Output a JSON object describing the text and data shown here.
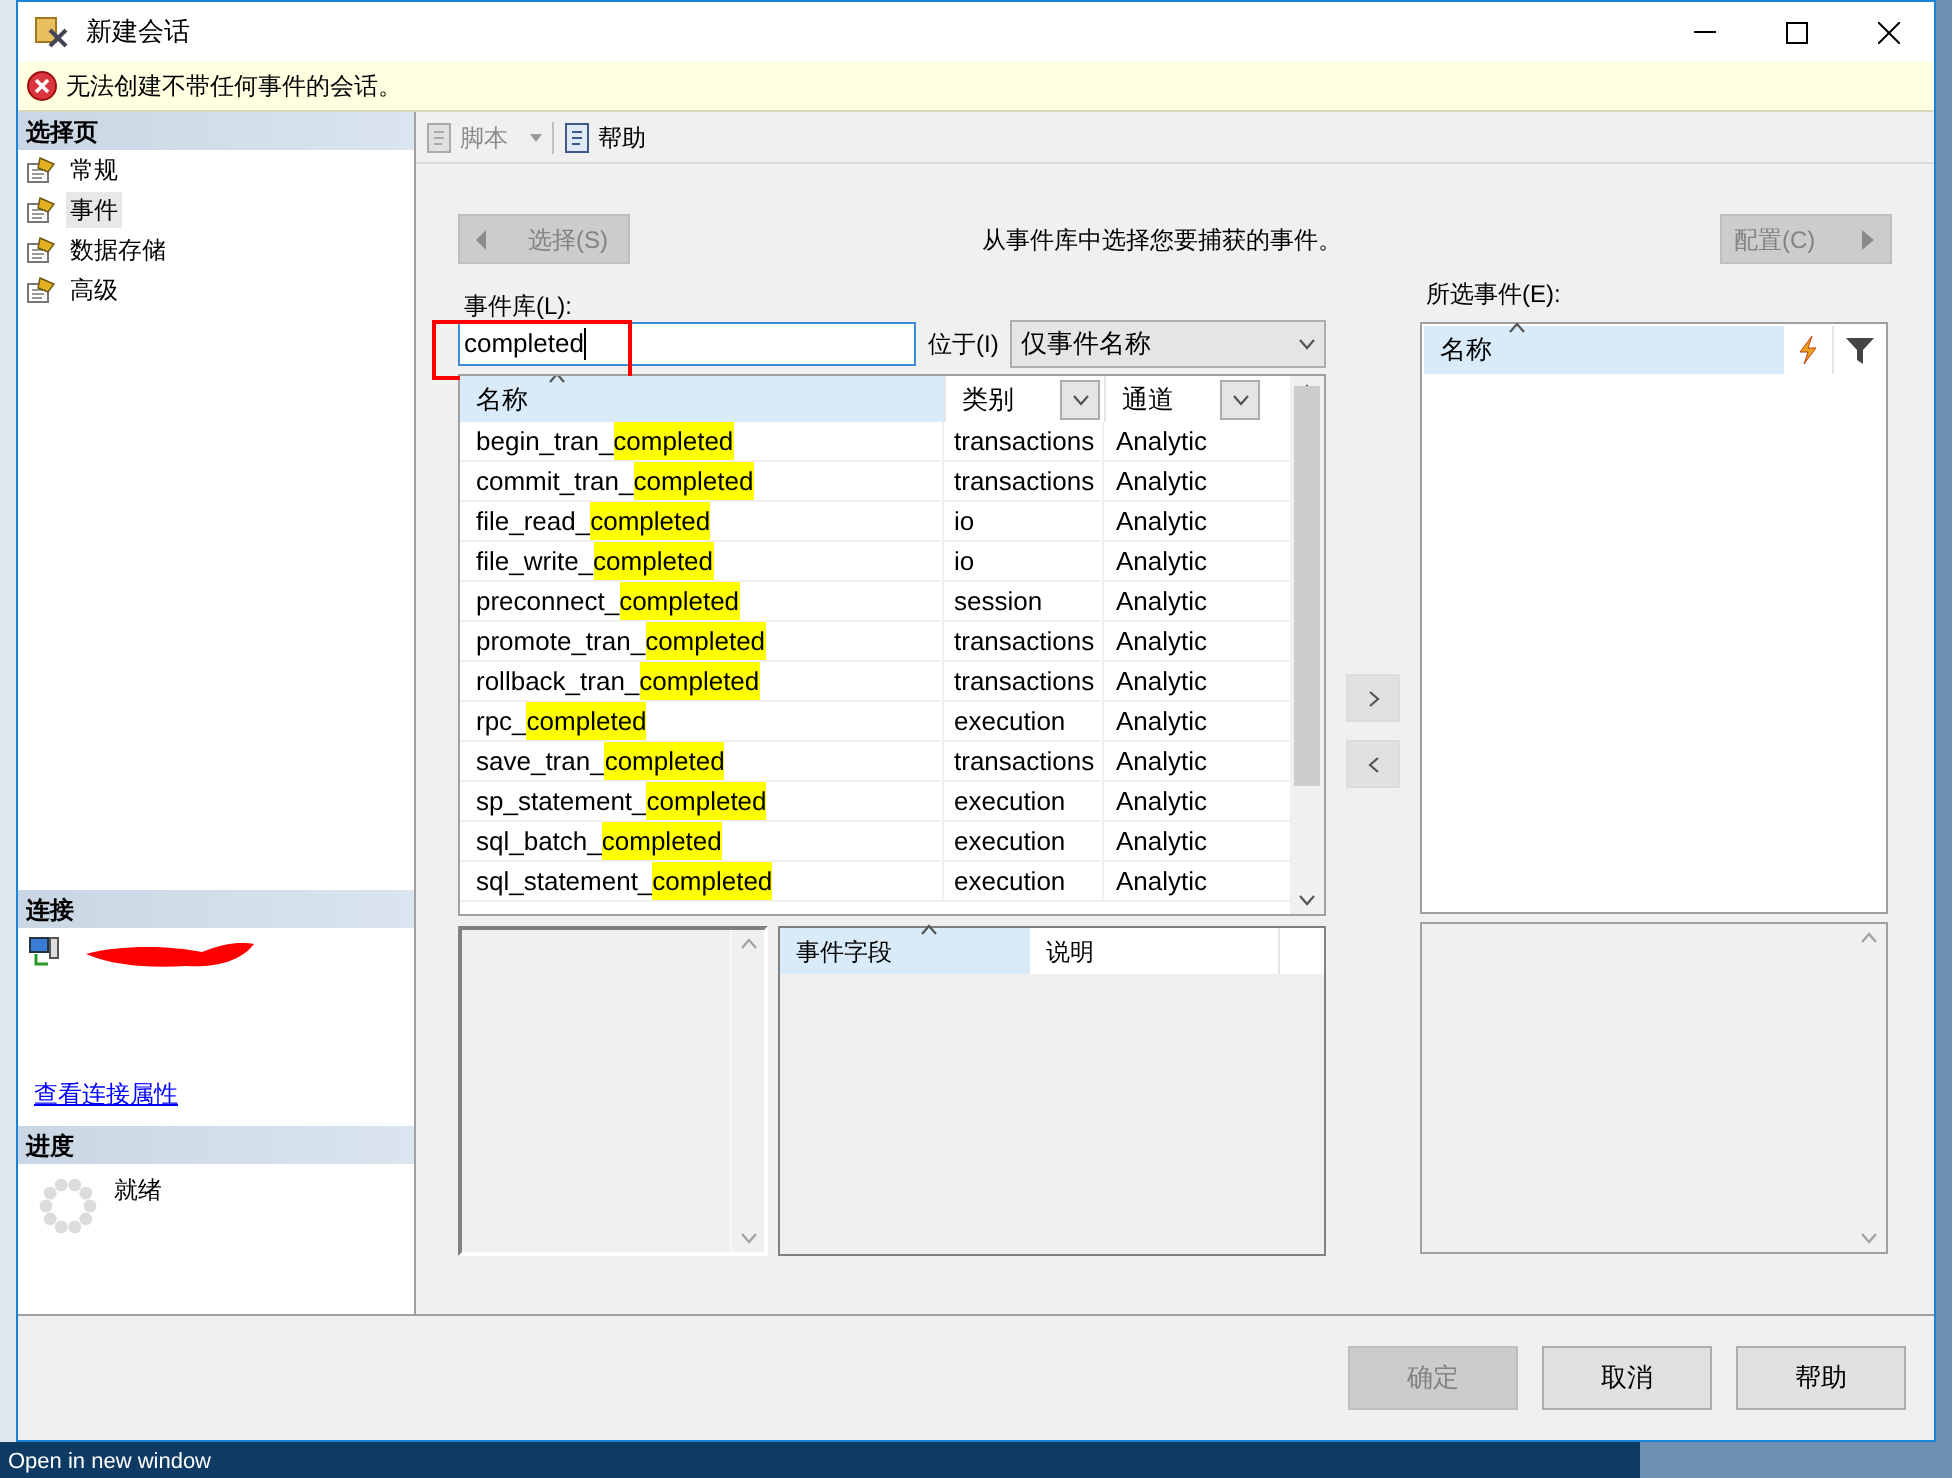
{
  "window": {
    "title": "新建会话"
  },
  "error_bar": {
    "message": "无法创建不带任何事件的会话。"
  },
  "sidebar": {
    "header": "选择页",
    "items": [
      {
        "label": "常规",
        "selected": false
      },
      {
        "label": "事件",
        "selected": true
      },
      {
        "label": "数据存储",
        "selected": false
      },
      {
        "label": "高级",
        "selected": false
      }
    ],
    "connection": {
      "header": "连接",
      "link": "查看连接属性"
    },
    "progress": {
      "header": "进度",
      "status": "就绪"
    }
  },
  "toolbar": {
    "items": [
      {
        "label": "脚本",
        "disabled": true,
        "has_menu": true
      },
      {
        "label": "帮助",
        "disabled": false,
        "has_menu": false
      }
    ]
  },
  "select_button": {
    "label": "选择(S)",
    "disabled": true
  },
  "instruction": "从事件库中选择您要捕获的事件。",
  "configure_button": {
    "label": "配置(C)",
    "disabled": true
  },
  "library": {
    "label": "事件库(L):",
    "search": "completed",
    "scope_label": "位于(I)",
    "scope": "仅事件名称",
    "columns": [
      "名称",
      "类别",
      "通道"
    ],
    "rows": [
      {
        "name": "begin_tran_",
        "match": "completed",
        "category": "transactions",
        "channel": "Analytic"
      },
      {
        "name": "commit_tran_",
        "match": "completed",
        "category": "transactions",
        "channel": "Analytic"
      },
      {
        "name": "file_read_",
        "match": "completed",
        "category": "io",
        "channel": "Analytic"
      },
      {
        "name": "file_write_",
        "match": "completed",
        "category": "io",
        "channel": "Analytic"
      },
      {
        "name": "preconnect_",
        "match": "completed",
        "category": "session",
        "channel": "Analytic"
      },
      {
        "name": "promote_tran_",
        "match": "completed",
        "category": "transactions",
        "channel": "Analytic"
      },
      {
        "name": "rollback_tran_",
        "match": "completed",
        "category": "transactions",
        "channel": "Analytic"
      },
      {
        "name": "rpc_",
        "match": "completed",
        "category": "execution",
        "channel": "Analytic"
      },
      {
        "name": "save_tran_",
        "match": "completed",
        "category": "transactions",
        "channel": "Analytic"
      },
      {
        "name": "sp_statement_",
        "match": "completed",
        "category": "execution",
        "channel": "Analytic"
      },
      {
        "name": "sql_batch_",
        "match": "completed",
        "category": "execution",
        "channel": "Analytic"
      },
      {
        "name": "sql_statement_",
        "match": "completed",
        "category": "execution",
        "channel": "Analytic"
      }
    ]
  },
  "selected_events": {
    "label": "所选事件(E):",
    "columns": [
      "名称"
    ]
  },
  "fields": {
    "columns": [
      "事件字段",
      "说明"
    ]
  },
  "buttons": [
    {
      "label": "确定",
      "disabled": true
    },
    {
      "label": "取消",
      "disabled": false
    },
    {
      "label": "帮助",
      "disabled": false
    }
  ],
  "taskbar": {
    "text": "Open in new window"
  }
}
